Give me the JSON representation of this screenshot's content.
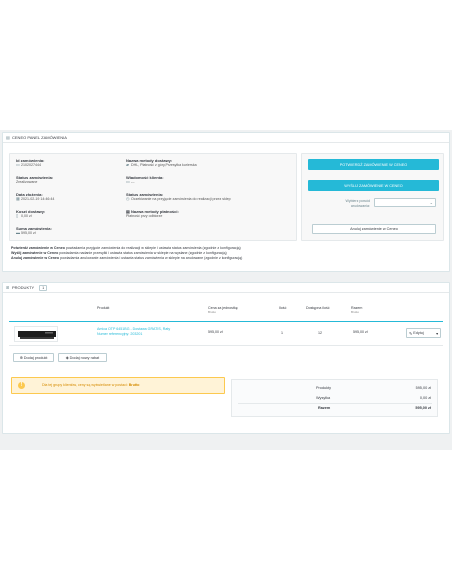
{
  "panel": {
    "title": "CENEO PANEL ZAMÓWIENIA",
    "left_fields": [
      {
        "label": "Id zamówienia:",
        "value": "2102027444",
        "icon": "id-card-icon"
      },
      {
        "label": "Status zamówienia:",
        "value": "Zrealizowane",
        "icon": ""
      },
      {
        "label": "Data złożenia:",
        "value": "2021-02-19 14:46:44",
        "icon": "calendar-icon"
      },
      {
        "label": "Koszt dostawy:",
        "value": "0,00 zł",
        "icon": "document-icon"
      },
      {
        "label": "Suma zamówienia:",
        "value": "595,00 zł",
        "icon": "money-icon"
      }
    ],
    "right_fields": [
      {
        "label": "Nazwa metody dostawy:",
        "value": "DHL, Płatność z góry,Przesyłka kurierska",
        "icon": "truck-icon"
      },
      {
        "label": "Wiadomość klienta:",
        "value": "---",
        "icon": "message-icon"
      },
      {
        "label": "Status zamówienia:",
        "value": "Oczekiwanie na przyjęcie zamówienia do realizacji przez sklep",
        "icon": "clock-icon"
      },
      {
        "label": "Nazwa metody płatności:",
        "value": "Płatność przy odbiorze",
        "icon": "payment-icon"
      }
    ],
    "confirm_button": "POTWIERDŹ ZAMÓWIENIE W CENEO",
    "ship_button": "WYŚLIJ ZAMÓWIENIE W CENEO",
    "reason_label": "Wybierz powód anulowania:",
    "reason_value": "",
    "cancel_button": "Anuluj zamówienie w Ceneo",
    "legend": [
      {
        "bold": "Potwierdź zamówienie w Ceneo",
        "text": "powiadamia przyjęcie zamówienia do realizacji w sklepie i ustawia status zamówienia (zgodnie z konfiguracją)"
      },
      {
        "bold": "Wyślij zamówienie w Ceneo",
        "text": "powiadamia nadanie przesyłki i ustawia status zamówienia w sklepie na wysłane (zgodnie z konfiguracją)"
      },
      {
        "bold": "Anuluj zamówienie w Ceneo",
        "text": "powiadamia anulowanie zamówienia i ustawia status zamówienia w sklepie na anulowane (zgodnie z konfiguracją)"
      }
    ]
  },
  "products": {
    "title": "PRODUKTY",
    "count": "1",
    "headers": {
      "product": "Produkt",
      "unit_price": "Cena za jednostkę",
      "unit_price_sub": "Brutto",
      "qty": "Ilość",
      "available": "Dostępna ilość",
      "total": "Razem",
      "total_sub": "Brutto"
    },
    "rows": [
      {
        "name": "Amica OTP 6451BG - Dostawa GRATIS, Raty",
        "ref": "Numer referencyjny: 203201",
        "unit_price": "595,00 zł",
        "qty": "1",
        "available": "12",
        "total": "595,00 zł",
        "edit": "Edytuj"
      }
    ],
    "add_product": "Dodaj produkt",
    "add_discount": "Dodaj nowy rabat",
    "warning": "Dla tej grupy klientów, ceny są wyświetlane w postaci:",
    "warning_bold": "Brutto",
    "summary": [
      {
        "label": "Produkty",
        "value": "595,00 zł"
      },
      {
        "label": "Wysyłka",
        "value": "0,00 zł"
      },
      {
        "label": "Razem",
        "value": "595,00 zł"
      }
    ]
  },
  "colors": {
    "accent": "#25b9d7",
    "warning_bg": "#fff3d7",
    "page_bg": "#eff1f2"
  }
}
